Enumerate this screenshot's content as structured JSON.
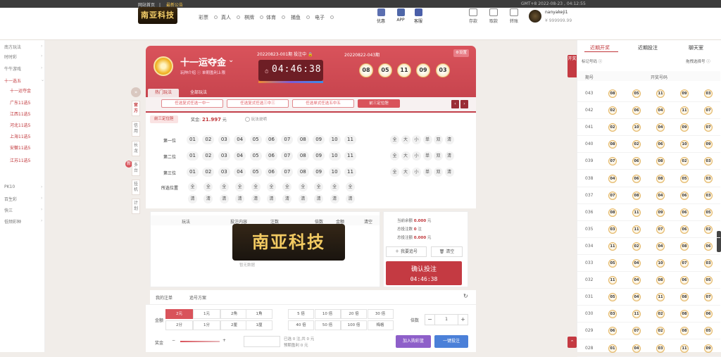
{
  "topbar": {
    "home": "网站首页",
    "notice": "最新公告",
    "time": "GMT+8   2022-08-23 , 04:12:55"
  },
  "logo": {
    "text": "南亚科技"
  },
  "nav": [
    "彩票",
    "真人",
    "棋牌",
    "体育",
    "捕鱼",
    "电子"
  ],
  "header_icons": [
    {
      "label": "优惠",
      "icon": "gift-icon"
    },
    {
      "label": "APP",
      "icon": "phone-icon"
    },
    {
      "label": "客服",
      "icon": "chat-icon"
    }
  ],
  "wallet_icons": [
    {
      "label": "存款",
      "icon": "deposit-icon"
    },
    {
      "label": "取款",
      "icon": "withdraw-icon"
    },
    {
      "label": "转账",
      "icon": "transfer-icon"
    }
  ],
  "user": {
    "name": "nanyakeji1",
    "balance": "¥ 999999.99"
  },
  "sidebar": [
    {
      "label": "南方玩法",
      "cls": "",
      "caret": "›"
    },
    {
      "label": "时时彩",
      "cls": "",
      "caret": "›"
    },
    {
      "label": "牛牛游戏",
      "cls": "",
      "caret": "›"
    },
    {
      "label": "十一选五",
      "cls": "",
      "caret": "⌄"
    },
    {
      "label": "十一运夺金",
      "cls": "sub",
      "caret": ""
    },
    {
      "label": "广东11选5",
      "cls": "sub",
      "caret": ""
    },
    {
      "label": "江西11选5",
      "cls": "sub",
      "caret": ""
    },
    {
      "label": "河北11选5",
      "cls": "sub",
      "caret": ""
    },
    {
      "label": "上海11选5",
      "cls": "sub",
      "caret": ""
    },
    {
      "label": "安徽11选5",
      "cls": "sub",
      "caret": ""
    },
    {
      "label": "江苏11选5",
      "cls": "sub",
      "caret": ""
    },
    {
      "label": "PK10",
      "cls": "",
      "caret": "›"
    },
    {
      "label": "百生彩",
      "cls": "",
      "caret": "›"
    },
    {
      "label": "快三",
      "cls": "",
      "caret": "›"
    },
    {
      "label": "低频彩种",
      "cls": "",
      "caret": "›"
    }
  ],
  "vertical_tabs": [
    "官方",
    "信用",
    "长龙",
    "多台",
    "挂机",
    "计划"
  ],
  "game": {
    "name": "十一运夺金",
    "sub": "玩种介绍 ⓘ    单期盈利上限",
    "current_issue": "20220823-001期  投注中 🔒",
    "countdown": "04:46:38",
    "prev_issue": "20220822-043期",
    "prev_numbers": [
      "08",
      "05",
      "11",
      "09",
      "03"
    ],
    "settings": "⚙设置"
  },
  "play_tabs": [
    "热门玩法",
    "全部玩法"
  ],
  "sub_tabs": [
    "任选复式任选一中一",
    "任选复式任选三中三",
    "任选单式任选五中五",
    "前三定位胆"
  ],
  "play": {
    "name": "前三定位胆",
    "prize_label": "奖金:",
    "prize_value": "21.997",
    "prize_unit": "元",
    "explain": "玩法说明",
    "rows": [
      "第一位",
      "第二位",
      "第三位"
    ],
    "numbers": [
      "01",
      "02",
      "03",
      "04",
      "05",
      "06",
      "07",
      "08",
      "09",
      "10",
      "11"
    ],
    "quick": [
      "全",
      "大",
      "小",
      "单",
      "双",
      "清"
    ],
    "position_label": "所选位置",
    "position_all": "全",
    "position_clear": "清"
  },
  "cart": {
    "headers": [
      "玩法",
      "投注内容",
      "注数",
      "倍数",
      "金额",
      "清空"
    ],
    "empty": "暂无数据",
    "balance_label": "当前余额",
    "balance": "0.000",
    "bets_label": "总投注数",
    "bets": "0",
    "amount_label": "总投注额",
    "amount": "0.000",
    "unit_yuan": "元",
    "unit_bets": "注",
    "random_btn": "我要追号",
    "clear_btn": "清空",
    "confirm": "确认投注",
    "confirm_timer": "04:46:38"
  },
  "watermark": "南亚科技",
  "orders": {
    "mine": "我的注单",
    "plan": "追号方案"
  },
  "controls": {
    "amount_label": "金额",
    "units": [
      "2元",
      "1元",
      "2角",
      "1角",
      "2分",
      "1分",
      "2厘",
      "1厘"
    ],
    "multipliers": [
      "5 倍",
      "10 倍",
      "20 倍",
      "30 倍",
      "40 倍",
      "50 倍",
      "100 倍",
      "梅格"
    ],
    "times_label": "倍数",
    "times_value": "1",
    "bonus_label": "奖金",
    "selected": "已选 0 注,共 0 元",
    "profit": "预期盈利 0 元",
    "add_cart": "加入购彩篮",
    "one_key": "一键投注"
  },
  "right": {
    "tabs": [
      "近期开奖",
      "近期投注",
      "聊天室"
    ],
    "select": "标记号码 ⓘ",
    "select2": "拖拽选择号 ⓘ",
    "col_issue": "期号",
    "col_numbers": "开奖号码",
    "side_tag": "开奖",
    "up": "⌃",
    "rows": [
      {
        "issue": "043",
        "nums": [
          "08",
          "05",
          "11",
          "09",
          "03"
        ]
      },
      {
        "issue": "042",
        "nums": [
          "02",
          "06",
          "04",
          "11",
          "07"
        ]
      },
      {
        "issue": "041",
        "nums": [
          "02",
          "10",
          "04",
          "09",
          "07"
        ]
      },
      {
        "issue": "040",
        "nums": [
          "08",
          "02",
          "06",
          "10",
          "09"
        ]
      },
      {
        "issue": "039",
        "nums": [
          "07",
          "06",
          "08",
          "02",
          "03"
        ]
      },
      {
        "issue": "038",
        "nums": [
          "04",
          "06",
          "08",
          "05",
          "03"
        ]
      },
      {
        "issue": "037",
        "nums": [
          "07",
          "08",
          "04",
          "06",
          "03"
        ]
      },
      {
        "issue": "036",
        "nums": [
          "08",
          "11",
          "09",
          "06",
          "05"
        ]
      },
      {
        "issue": "035",
        "nums": [
          "03",
          "11",
          "07",
          "06",
          "02"
        ]
      },
      {
        "issue": "034",
        "nums": [
          "11",
          "02",
          "04",
          "08",
          "06"
        ]
      },
      {
        "issue": "033",
        "nums": [
          "05",
          "04",
          "10",
          "07",
          "03"
        ]
      },
      {
        "issue": "032",
        "nums": [
          "11",
          "04",
          "08",
          "06",
          "05"
        ]
      },
      {
        "issue": "031",
        "nums": [
          "05",
          "04",
          "11",
          "08",
          "07"
        ]
      },
      {
        "issue": "030",
        "nums": [
          "03",
          "11",
          "02",
          "08",
          "06"
        ]
      },
      {
        "issue": "029",
        "nums": [
          "06",
          "07",
          "02",
          "08",
          "05"
        ]
      },
      {
        "issue": "028",
        "nums": [
          "01",
          "04",
          "03",
          "11",
          "09"
        ]
      }
    ]
  }
}
